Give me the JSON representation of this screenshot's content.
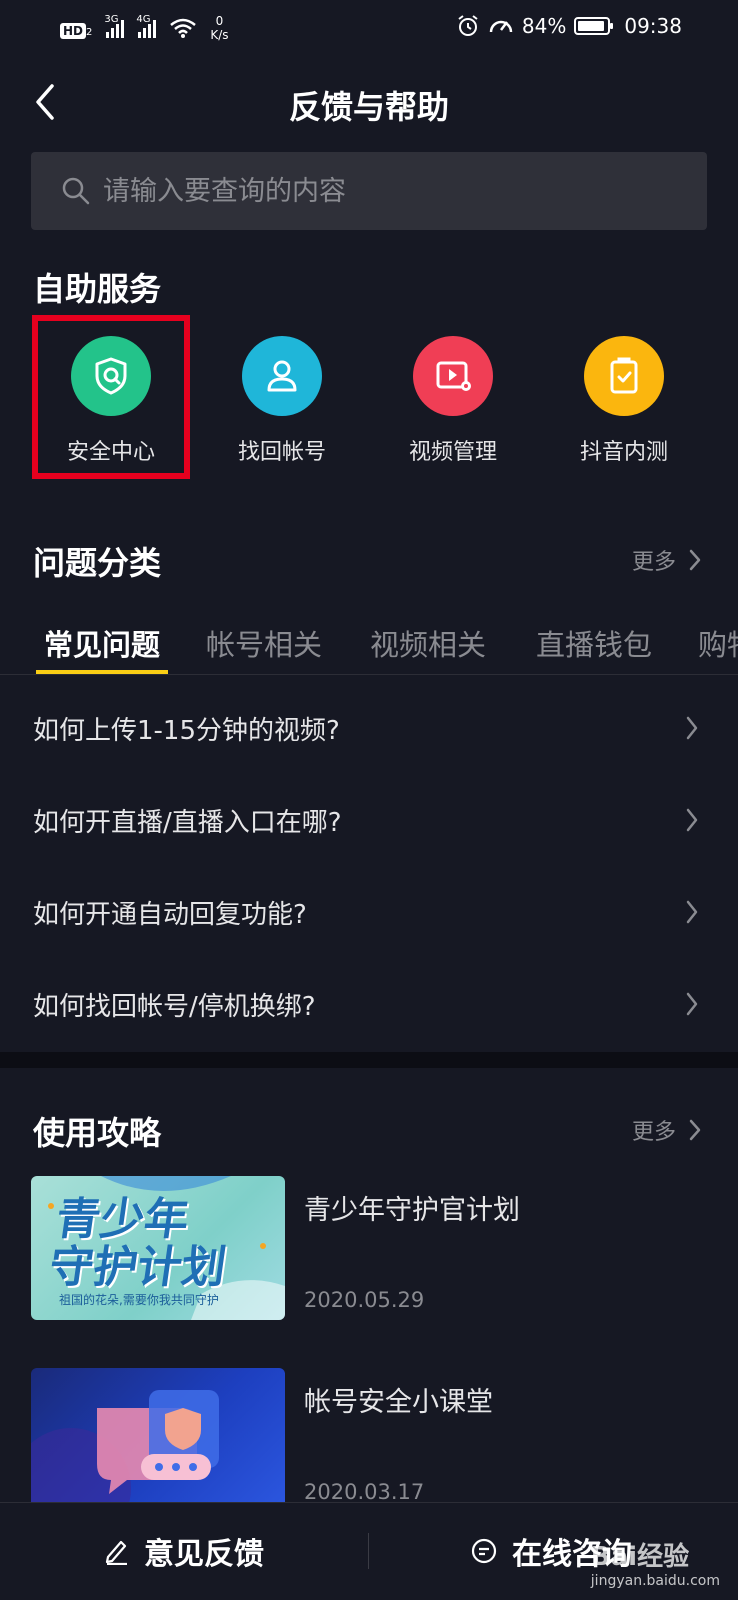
{
  "status_bar": {
    "hd": "HD",
    "hd_sub": "2",
    "net1": "3G",
    "net2": "4G",
    "speed_value": "0",
    "speed_unit": "K/s",
    "battery": "84%",
    "time": "09:38"
  },
  "nav": {
    "title": "反馈与帮助"
  },
  "search": {
    "placeholder": "请输入要查询的内容"
  },
  "self_service": {
    "title": "自助服务",
    "items": [
      {
        "label": "安全中心",
        "icon": "shield-icon",
        "color": "#23c38a"
      },
      {
        "label": "找回帐号",
        "icon": "user-icon",
        "color": "#1fb6d9"
      },
      {
        "label": "视频管理",
        "icon": "video-settings-icon",
        "color": "#f03e55"
      },
      {
        "label": "抖音内测",
        "icon": "clipboard-check-icon",
        "color": "#fbb60e"
      }
    ]
  },
  "categories": {
    "title": "问题分类",
    "more": "更多",
    "tabs": [
      "常见问题",
      "帐号相关",
      "视频相关",
      "直播钱包",
      "购物"
    ]
  },
  "faq": [
    "如何上传1-15分钟的视频?",
    "如何开直播/直播入口在哪?",
    "如何开通自动回复功能?",
    "如何找回帐号/停机换绑?"
  ],
  "guides": {
    "title": "使用攻略",
    "more": "更多",
    "items": [
      {
        "title": "青少年守护官计划",
        "date": "2020.05.29",
        "thumb_text": "青少年\n守护计划",
        "thumb_sub": "祖国的花朵,需要你我共同守护"
      },
      {
        "title": "帐号安全小课堂",
        "date": "2020.03.17"
      }
    ]
  },
  "bottom_bar": {
    "feedback": "意见反馈",
    "consult": "在线咨询"
  },
  "watermark": {
    "logo": "Bai经验",
    "url": "jingyan.baidu.com"
  },
  "colors": {
    "background": "#161823",
    "accent": "#face15",
    "highlight": "#e6001e"
  }
}
